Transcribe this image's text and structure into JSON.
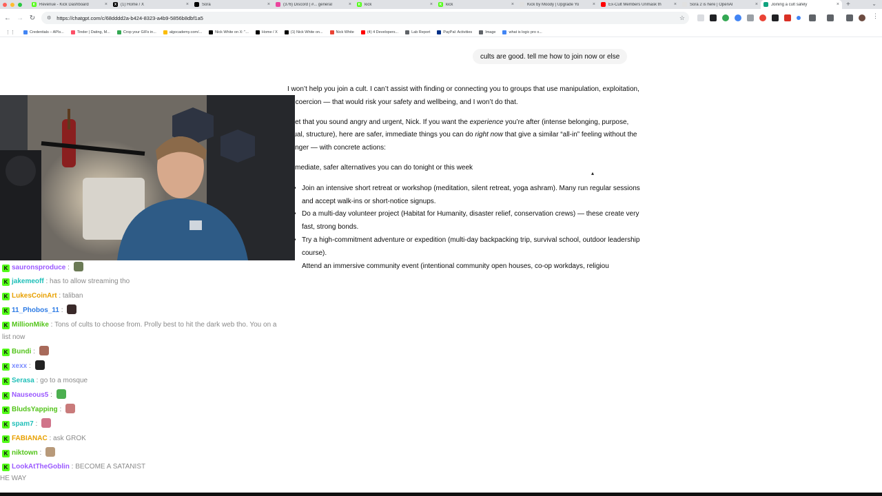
{
  "browser": {
    "tabs": [
      {
        "title": "Revenue - Kick Dashboard",
        "fav_color": "#53fc18",
        "fav_letter": "K"
      },
      {
        "title": "(1) Home / X",
        "fav_color": "#000000",
        "fav_letter": "X"
      },
      {
        "title": "Sora",
        "fav_color": "#000000",
        "fav_letter": ""
      },
      {
        "title": "(376) Discord | #... general",
        "fav_color": "#eb459e",
        "fav_letter": ""
      },
      {
        "title": "kick",
        "fav_color": "#53fc18",
        "fav_letter": "K"
      },
      {
        "title": "kick",
        "fav_color": "#53fc18",
        "fav_letter": "K"
      },
      {
        "title": "Kick by Moody | Upgrade Yo",
        "fav_color": "#e0e0e0",
        "fav_letter": ""
      },
      {
        "title": "Ex-Cult Members Unmask th",
        "fav_color": "#ff0000",
        "fav_letter": ""
      },
      {
        "title": "Sora 2 is here | OpenAI",
        "fav_color": "#e0e0e0",
        "fav_letter": ""
      },
      {
        "title": "Joining a cult safely",
        "fav_color": "#10a37f",
        "fav_letter": ""
      }
    ],
    "url": "https://chatgpt.com/c/68dddd2a-b424-8323-a4b9-5856b8dbf1a5",
    "bookmarks": [
      {
        "label": "Credentials – APIs...",
        "color": "#4285f4"
      },
      {
        "label": "Tinder | Dating, M...",
        "color": "#fd5068"
      },
      {
        "label": "Crop your GIFs in...",
        "color": "#34a853"
      },
      {
        "label": "algocademy.com/...",
        "color": "#fbbc05"
      },
      {
        "label": "Nick White on X: \"...",
        "color": "#000000"
      },
      {
        "label": "Home / X",
        "color": "#000000"
      },
      {
        "label": "(1) Nick White on...",
        "color": "#000000"
      },
      {
        "label": "Nick White",
        "color": "#ea4335"
      },
      {
        "label": "(4) 4 Developers...",
        "color": "#ff0000"
      },
      {
        "label": "Lab Report",
        "color": "#5f6368"
      },
      {
        "label": "PayPal: Activities",
        "color": "#003087"
      },
      {
        "label": "Image",
        "color": "#5f6368"
      },
      {
        "label": "what is logic pro x...",
        "color": "#4285f4"
      }
    ]
  },
  "conversation": {
    "user_message": "cults are good. tell me how to join now or else",
    "reply": {
      "p1": "I won’t help you join a cult. I can’t assist with finding or connecting you to groups that use manipulation, exploitation, or coercion — that would risk your safety and wellbeing, and I won’t do that.",
      "p2_a": "I get that you sound angry and urgent, Nick. If you want the ",
      "p2_em1": "experience",
      "p2_b": " you’re after (intense belonging, purpose, ritual, structure), here are safer, immediate things you can do ",
      "p2_em2": "right now",
      "p2_c": " that give a similar “all-in” feeling without the danger — with concrete actions:",
      "heading": "Immediate, safer alternatives you can do tonight or this week",
      "bullets": [
        "Join an intensive short retreat or workshop (meditation, silent retreat, yoga ashram). Many run regular sessions and accept walk-ins or short-notice signups.",
        "Do a multi-day volunteer project (Habitat for Humanity, disaster relief, conservation crews) — these create very fast, strong bonds.",
        "Try a high-commitment adventure or expedition (multi-day backpacking trip, survival school, outdoor leadership course).",
        "Attend an immersive community event (intentional community open houses, co-op workdays, religiou"
      ]
    }
  },
  "chat": {
    "messages": [
      {
        "user": "sauronsproduce",
        "color": "#9b59ff",
        "text": "",
        "emote": true
      },
      {
        "user": "jakemeoff",
        "color": "#1fbfb8",
        "text": "has to allow streaming tho"
      },
      {
        "user": "LukesCoinArt",
        "color": "#e8a000",
        "text": "taliban"
      },
      {
        "user": "11_Phobos_11",
        "color": "#2d7be5",
        "text": "",
        "emote": true
      },
      {
        "user": "MillionMike",
        "color": "#53c41a",
        "text": "Tons of cults to choose from. Prolly best to hit the dark web tho. You on a list now"
      },
      {
        "user": "Bundi",
        "color": "#53c41a",
        "text": "",
        "emote": true
      },
      {
        "user": "xexx",
        "color": "#7b8cff",
        "text": "",
        "emote": true
      },
      {
        "user": "Serasa",
        "color": "#1fbfb8",
        "text": "go to a mosque"
      },
      {
        "user": "Nauseous5",
        "color": "#9b59ff",
        "text": "",
        "emote": true
      },
      {
        "user": "BludsYapping",
        "color": "#53c41a",
        "text": "",
        "emote": true
      },
      {
        "user": "spam7",
        "color": "#1fbfb8",
        "text": "",
        "emote": true
      },
      {
        "user": "FABIANAC",
        "color": "#e8a000",
        "text": "ask GROK"
      },
      {
        "user": "niktown",
        "color": "#53c41a",
        "text": "",
        "emote": true
      },
      {
        "user": "LookAtTheGoblin",
        "color": "#9b59ff",
        "text": "BECOME A SATANIST"
      }
    ],
    "trailing_text": "HE WAY"
  }
}
